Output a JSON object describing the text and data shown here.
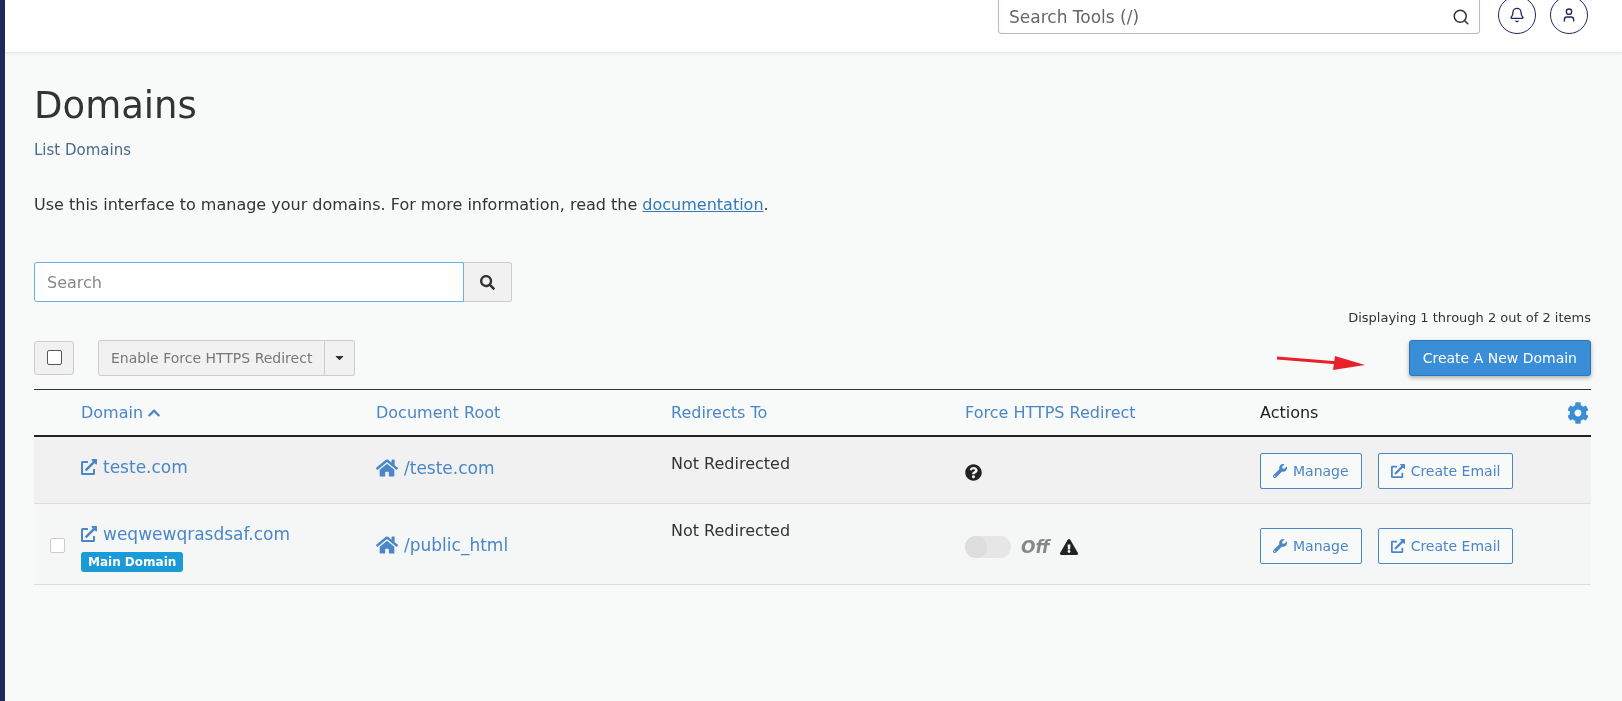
{
  "header": {
    "search": {
      "placeholder": "Search Tools (/)"
    }
  },
  "page": {
    "title": "Domains",
    "subtitle": "List Domains",
    "description": "Use this interface to manage your domains. For more information, read the ",
    "doc_link": "documentation",
    "description_end": "."
  },
  "search": {
    "placeholder": "Search"
  },
  "paging": "Displaying 1 through 2 out of 2 items",
  "toolbar": {
    "select_all": {
      "checked": false
    },
    "bulk_action": "Enable Force HTTPS Redirect",
    "create_button": "Create A New Domain"
  },
  "table": {
    "columns": [
      {
        "label": "Domain",
        "sorted": true
      },
      {
        "label": "Document Root",
        "sorted": false
      },
      {
        "label": "Redirects To",
        "sorted": false
      },
      {
        "label": "Force HTTPS Redirect",
        "sorted": false
      },
      {
        "label": "Actions",
        "sorted": false
      }
    ],
    "rows": [
      {
        "domain": "teste.com",
        "doc_root": "/teste.com",
        "redirects": "Not Redirected",
        "force": {
          "kind": "help"
        },
        "actions": [
          "Manage",
          "Create Email"
        ]
      },
      {
        "domain": "weqwewqrasdsaf.com",
        "badge": "Main Domain",
        "checked": false,
        "doc_root": "/public_html",
        "redirects": "Not Redirected",
        "force": {
          "kind": "toggle",
          "on": false,
          "label": "Off"
        },
        "actions": [
          "Manage",
          "Create Email"
        ]
      }
    ]
  }
}
